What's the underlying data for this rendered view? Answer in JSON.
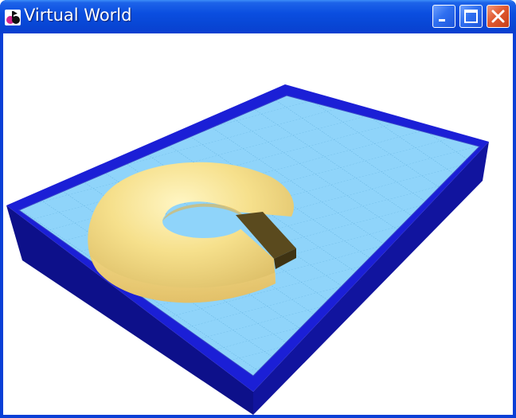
{
  "window": {
    "title": "Virtual World",
    "icon": "vrml-app-icon",
    "buttons": [
      "minimize-icon",
      "maximize-icon",
      "close-icon"
    ]
  },
  "scene": {
    "objects": [
      "floor-board",
      "blue-frame",
      "cut-torus"
    ],
    "colors": {
      "floor": "#8fd4fa",
      "grid": "#4a9fd1",
      "frame_top": "#1b1fd6",
      "frame_side": "#0d108a",
      "torus": "#f6e08c",
      "torus_cut": "#5a4a1e",
      "background": "#ffffff"
    }
  }
}
